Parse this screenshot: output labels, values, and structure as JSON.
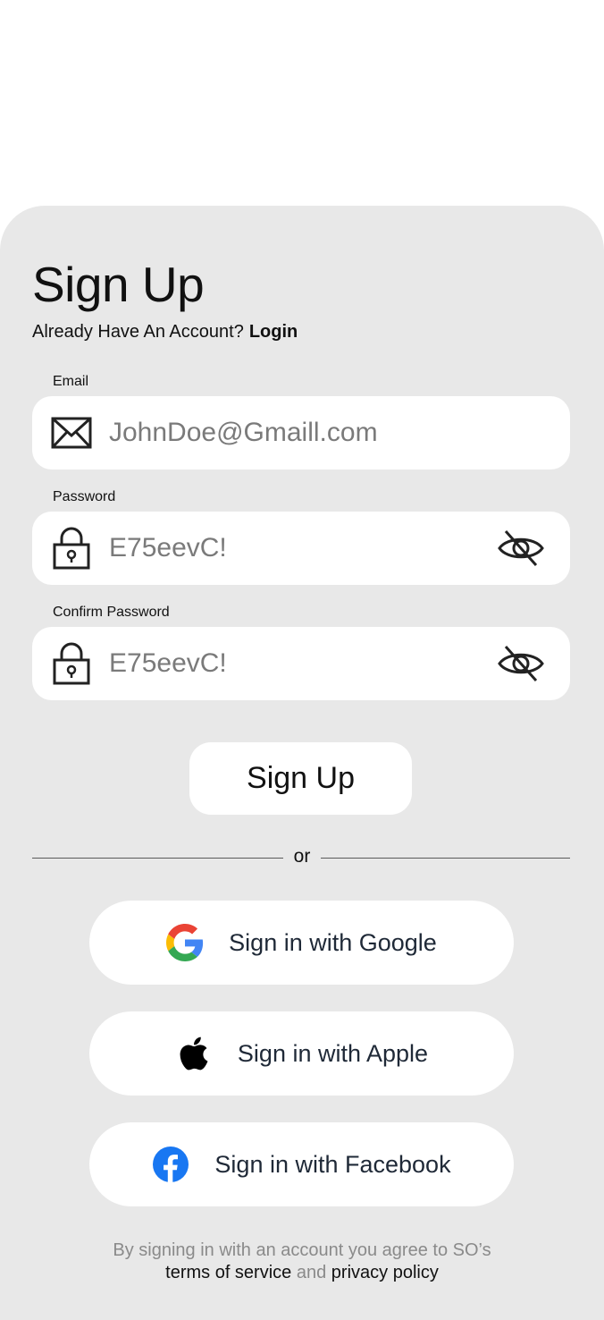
{
  "form": {
    "title": "Sign Up",
    "have_account_text": "Already Have An Account?",
    "login_link": "Login"
  },
  "fields": {
    "email": {
      "label": "Email",
      "value": "JohnDoe@Gmaill.com",
      "icon": "mail-icon"
    },
    "password": {
      "label": "Password",
      "value": "E75eevC!",
      "icon": "lock-icon",
      "toggle_icon": "eye-off-icon"
    },
    "confirm_password": {
      "label": "Confirm Password",
      "value": "E75eevC!",
      "icon": "lock-icon",
      "toggle_icon": "eye-off-icon"
    }
  },
  "submit_label": "Sign Up",
  "divider_text": "or",
  "social": {
    "google": {
      "label": "Sign in with Google",
      "icon": "google-icon"
    },
    "apple": {
      "label": "Sign in with Apple",
      "icon": "apple-icon"
    },
    "facebook": {
      "label": "Sign in with Facebook",
      "icon": "facebook-icon",
      "color": "#1877F2"
    }
  },
  "legal": {
    "line1": "By signing in with an account you agree to SO’s",
    "terms_link": "terms of service",
    "and_text": "and",
    "privacy_link": "privacy policy"
  },
  "colors": {
    "sheet_background": "#E8E8E8",
    "field_background": "#FFFFFF",
    "placeholder_text": "#7A7A7A"
  }
}
